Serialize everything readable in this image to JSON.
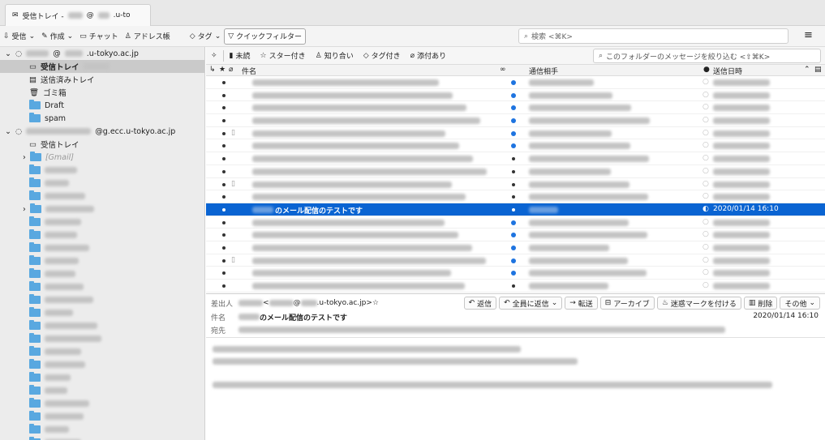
{
  "tab": {
    "title": "受信トレイ - ",
    "title_suffix": "@",
    "title_domain": ".u-to"
  },
  "toolbar": {
    "get": "受信",
    "write": "作成",
    "chat": "チャット",
    "address": "アドレス帳",
    "tag": "タグ",
    "quickfilter": "クイックフィルター",
    "search_placeholder": "検索 <⌘K>"
  },
  "sidebar": {
    "acct1": {
      "name": "@",
      "domain": ".u-tokyo.ac.jp"
    },
    "acct1_folders": [
      {
        "label": "受信トレイ",
        "selected": true,
        "icon": "inbox-icon"
      },
      {
        "label": "送信済みトレイ",
        "icon": "sent-icon"
      },
      {
        "label": "ゴミ箱",
        "icon": "trash-icon"
      },
      {
        "label": "Draft",
        "icon": "folder-icon"
      },
      {
        "label": "spam",
        "icon": "folder-icon"
      }
    ],
    "acct2": {
      "name": "@g.ecc.u-tokyo.ac.jp"
    },
    "acct2_inbox": "受信トレイ",
    "gmail": "[Gmail]"
  },
  "quickfilter": {
    "unread": "未読",
    "starred": "スター付き",
    "contacts": "知り合い",
    "tagged": "タグ付き",
    "attach": "添付あり",
    "search_placeholder": "このフォルダーのメッセージを絞り込む <⇧⌘K>"
  },
  "columns": {
    "subject": "件名",
    "correspondent": "通信相手",
    "date": "送信日時"
  },
  "selected_message": {
    "subject": "のメール配信のテストです",
    "date": "2020/01/14 16:10"
  },
  "header": {
    "from_label": "差出人",
    "from_open": "<",
    "from_at": "@",
    "from_domain": ".u-tokyo.ac.jp>",
    "subject_label": "件名",
    "subject": "のメール配信のテストです",
    "to_label": "宛先",
    "date": "2020/01/14 16:10"
  },
  "actions": {
    "reply": "返信",
    "reply_all": "全員に返信",
    "forward": "転送",
    "archive": "アーカイブ",
    "junk": "迷惑マークを付ける",
    "delete": "削除",
    "other": "その他"
  },
  "colors": {
    "accent": "#0a64d2",
    "folder": "#59a8e0"
  }
}
